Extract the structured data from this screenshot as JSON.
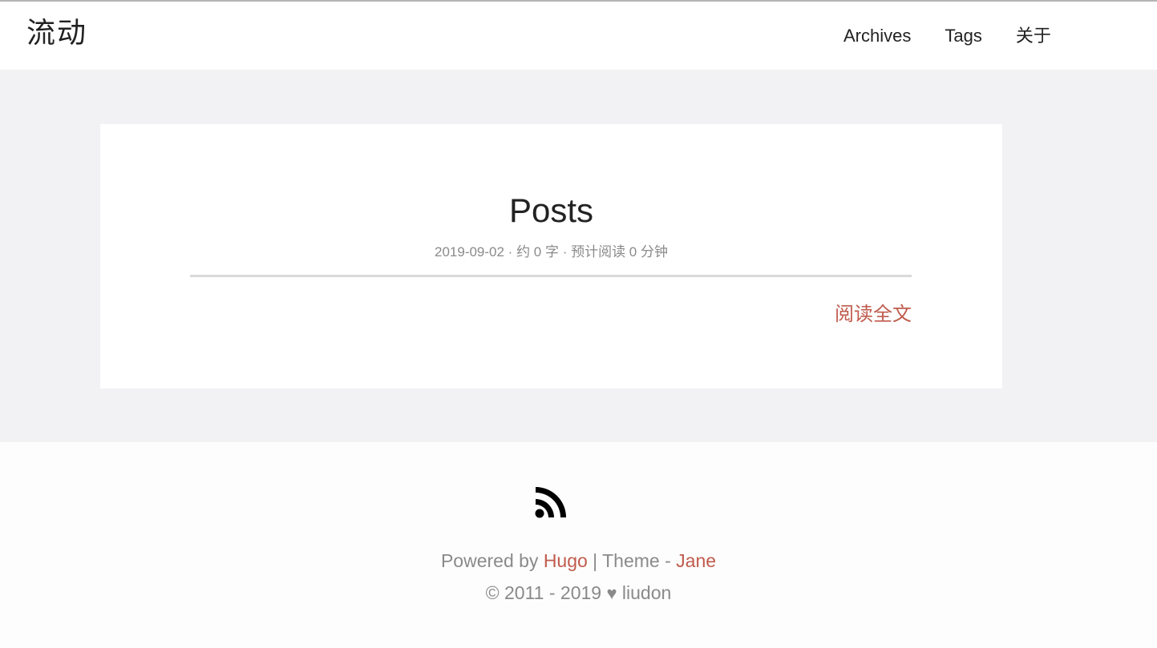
{
  "header": {
    "logo": "流动",
    "nav": [
      {
        "label": "Archives"
      },
      {
        "label": "Tags"
      },
      {
        "label": "关于"
      }
    ]
  },
  "post": {
    "title": "Posts",
    "meta": "2019-09-02 · 约 0 字 · 预计阅读 0 分钟",
    "read_more": "阅读全文"
  },
  "footer": {
    "rss_icon": "rss-icon",
    "powered_prefix": "Powered by ",
    "powered_link": "Hugo",
    "theme_separator": " | Theme - ",
    "theme_link": "Jane",
    "copyright_prefix": "© 2011 - 2019 ",
    "heart_icon": "♥",
    "author": " liudon"
  },
  "colors": {
    "accent": "#c05b4d",
    "background": "#f2f2f4",
    "card": "#ffffff",
    "muted_text": "#8a8a8a"
  }
}
